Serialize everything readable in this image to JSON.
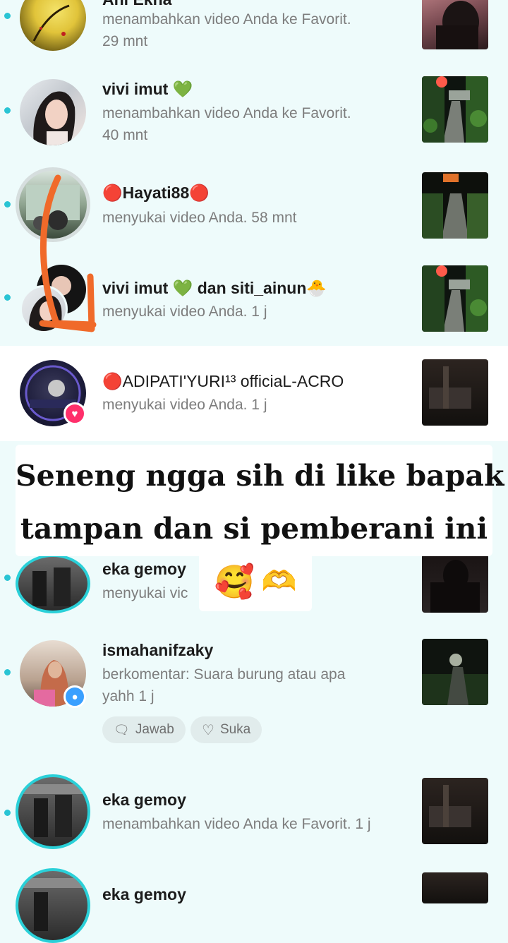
{
  "notifications": [
    {
      "name": "Ani Ekna",
      "action": "menambahkan video Anda ke Favorit.",
      "time": "29 mnt"
    },
    {
      "name": "vivi imut",
      "action": "menambahkan video Anda ke Favorit.",
      "time": "40 mnt"
    },
    {
      "name": "Hayati88",
      "action": "menyukai video Anda. 58 mnt"
    },
    {
      "name": "vivi imut",
      "name_sep": "dan",
      "name2": "siti_ainun",
      "action": "menyukai video Anda. 1 j"
    },
    {
      "name": "ADIPATI'YURI¹³ officiaL-ACRO",
      "action": "menyukai video Anda. 1 j"
    },
    {
      "name": "eka gemoy",
      "action": "menyukai vic"
    },
    {
      "name": "ismahanifzaky",
      "action": "berkomentar: Suara burung atau apa",
      "action2": "yahh 1 j",
      "reply_label": "Jawab",
      "like_label": "Suka"
    },
    {
      "name": "eka gemoy",
      "action": "menambahkan video Anda ke Favorit. 1 j"
    },
    {
      "name": "eka gemoy"
    }
  ],
  "caption": {
    "line1": "Seneng ngga sih di like bapak",
    "line2": "tampan dan si pemberani ini"
  },
  "colors": {
    "unread_dot": "#29c4d4",
    "heart_badge": "#ff2f6b",
    "comment_badge": "#3aa0ff",
    "arrow": "#f06a2a",
    "highlight_bg": "#ffffff"
  }
}
